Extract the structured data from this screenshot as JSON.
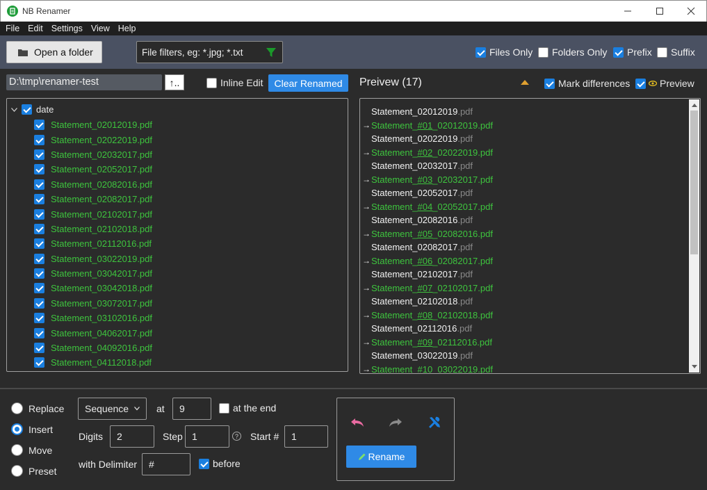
{
  "window": {
    "title": "NB Renamer"
  },
  "menu": [
    "File",
    "Edit",
    "Settings",
    "View",
    "Help"
  ],
  "toolbar": {
    "open_folder_label": "Open a folder",
    "filter_placeholder": "File filters, eg: *.jpg; *.txt",
    "files_only": {
      "label": "Files Only",
      "checked": true
    },
    "folders_only": {
      "label": "Folders Only",
      "checked": false
    },
    "prefix": {
      "label": "Prefix",
      "checked": true
    },
    "suffix": {
      "label": "Suffix",
      "checked": false
    }
  },
  "path": {
    "value": "D:\\tmp\\renamer-test",
    "up_label": "↑..",
    "inline_edit": {
      "label": "Inline Edit",
      "checked": false
    },
    "clear_renamed_label": "Clear Renamed"
  },
  "preview_header": {
    "title": "Preivew (17)",
    "mark_differences": {
      "label": "Mark differences",
      "checked": true
    },
    "preview": {
      "label": "Preview",
      "checked": true
    }
  },
  "tree": {
    "root": "date",
    "items": [
      "Statement_02012019.pdf",
      "Statement_02022019.pdf",
      "Statement_02032017.pdf",
      "Statement_02052017.pdf",
      "Statement_02082016.pdf",
      "Statement_02082017.pdf",
      "Statement_02102017.pdf",
      "Statement_02102018.pdf",
      "Statement_02112016.pdf",
      "Statement_03022019.pdf",
      "Statement_03042017.pdf",
      "Statement_03042018.pdf",
      "Statement_03072017.pdf",
      "Statement_03102016.pdf",
      "Statement_04062017.pdf",
      "Statement_04092016.pdf",
      "Statement_04112018.pdf"
    ]
  },
  "preview": [
    {
      "base": "Statement_02012019",
      "ext": ".pdf",
      "pre": "Statement_",
      "ins": "#01",
      "post": "_02012019.pdf"
    },
    {
      "base": "Statement_02022019",
      "ext": ".pdf",
      "pre": "Statement_",
      "ins": "#02",
      "post": "_02022019.pdf"
    },
    {
      "base": "Statement_02032017",
      "ext": ".pdf",
      "pre": "Statement_",
      "ins": "#03",
      "post": "_02032017.pdf"
    },
    {
      "base": "Statement_02052017",
      "ext": ".pdf",
      "pre": "Statement_",
      "ins": "#04",
      "post": "_02052017.pdf"
    },
    {
      "base": "Statement_02082016",
      "ext": ".pdf",
      "pre": "Statement_",
      "ins": "#05",
      "post": "_02082016.pdf"
    },
    {
      "base": "Statement_02082017",
      "ext": ".pdf",
      "pre": "Statement_",
      "ins": "#06",
      "post": "_02082017.pdf"
    },
    {
      "base": "Statement_02102017",
      "ext": ".pdf",
      "pre": "Statement_",
      "ins": "#07",
      "post": "_02102017.pdf"
    },
    {
      "base": "Statement_02102018",
      "ext": ".pdf",
      "pre": "Statement_",
      "ins": "#08",
      "post": "_02102018.pdf"
    },
    {
      "base": "Statement_02112016",
      "ext": ".pdf",
      "pre": "Statement_",
      "ins": "#09",
      "post": "_02112016.pdf"
    },
    {
      "base": "Statement_03022019",
      "ext": ".pdf",
      "pre": "Statement_",
      "ins": "#10",
      "post": "_03022019.pdf"
    }
  ],
  "modes": [
    {
      "label": "Replace",
      "selected": false
    },
    {
      "label": "Insert",
      "selected": true
    },
    {
      "label": "Move",
      "selected": false
    },
    {
      "label": "Preset",
      "selected": false
    }
  ],
  "options": {
    "type": "Sequence",
    "at_label": "at",
    "at_value": "9",
    "at_end": {
      "label": "at the end",
      "checked": false
    },
    "digits_label": "Digits",
    "digits_value": "2",
    "step_label": "Step",
    "step_value": "1",
    "start_label": "Start #",
    "start_value": "1",
    "delimiter_label": "with Delimiter",
    "delimiter_value": "#",
    "before": {
      "label": "before",
      "checked": true
    }
  },
  "actions": {
    "rename_label": "Rename",
    "undo_icon": "undo-icon",
    "redo_icon": "redo-icon",
    "tools_icon": "tools-icon"
  },
  "colors": {
    "accent": "#2f8ae6",
    "renamed_green": "#3ec43e",
    "toolbar_bg": "#4a5162",
    "undo_pink": "#e86aa0"
  }
}
